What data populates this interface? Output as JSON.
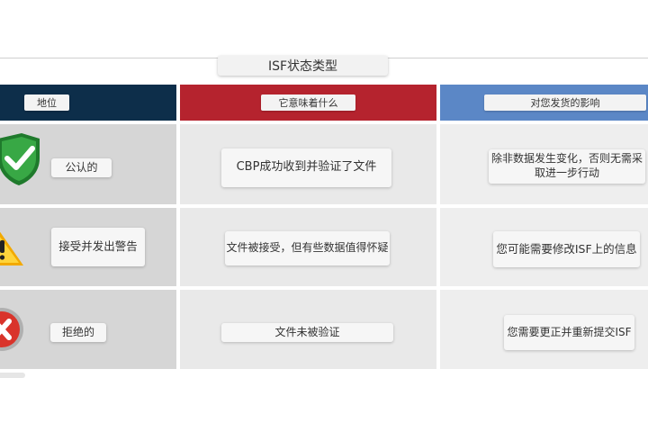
{
  "title": "ISF状态类型",
  "headers": {
    "status": "地位",
    "meaning": "它意味着什么",
    "impact": "对您发货的影响"
  },
  "rows": [
    {
      "status": "公认的",
      "meaning": "CBP成功收到并验证了文件",
      "impact": "除非数据发生变化，否则无需采取进一步行动",
      "icon": "green-shield-check-icon"
    },
    {
      "status": "接受并发出警告",
      "meaning": "文件被接受，但有些数据值得怀疑",
      "impact": "您可能需要修改ISF上的信息",
      "icon": "yellow-warning-triangle-icon"
    },
    {
      "status": "拒绝的",
      "meaning": "文件未被验证",
      "impact": "您需要更正并重新提交ISF",
      "icon": "red-x-circle-icon"
    }
  ],
  "colors": {
    "status_header": "#0d2e4a",
    "meaning_header": "#b5232e",
    "impact_header": "#5b87c6",
    "accepted": "#2f9a3a",
    "warning": "#f5c518",
    "rejected": "#d9342b"
  }
}
